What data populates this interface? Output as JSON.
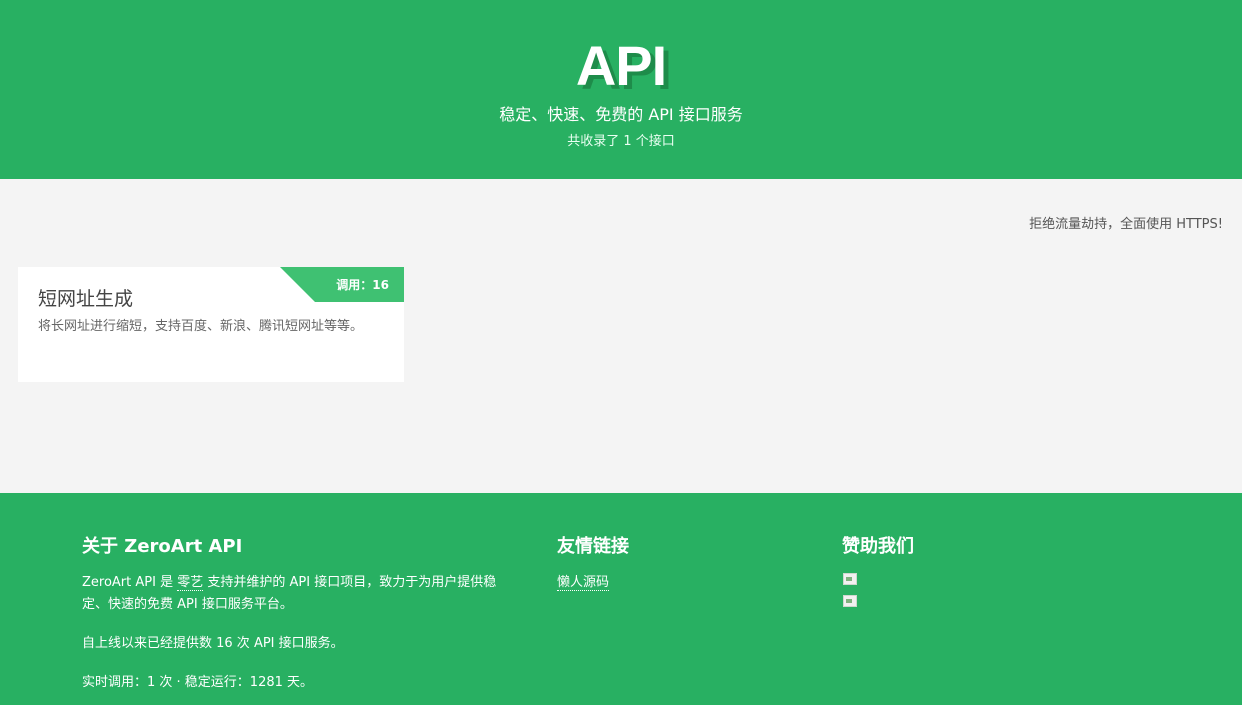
{
  "header": {
    "logo": "API",
    "tagline": "稳定、快速、免费的 API 接口服务",
    "count": "共收录了 1 个接口"
  },
  "main": {
    "notice": "拒绝流量劫持，全面使用 HTTPS!",
    "cards": [
      {
        "ribbon": "调用：16",
        "title": "短网址生成",
        "description": "将长网址进行缩短，支持百度、新浪、腾讯短网址等等。"
      }
    ]
  },
  "footer": {
    "about": {
      "heading": "关于 ZeroArt API",
      "intro_prefix": "ZeroArt API 是",
      "intro_link": "零艺",
      "intro_suffix": "支持并维护的 API 接口项目，致力于为用户提供稳定、快速的免费 API 接口服务平台。",
      "served": "自上线以来已经提供数 16 次 API 接口服务。",
      "stats": "实时调用：1 次 · 稳定运行：1281 天。"
    },
    "links": {
      "heading": "友情链接",
      "items": [
        "懒人源码"
      ]
    },
    "sponsor": {
      "heading": "赞助我们"
    }
  },
  "colors": {
    "brand_green": "#28b062",
    "ribbon_green": "#3fc172",
    "page_bg": "#f4f4f4"
  }
}
